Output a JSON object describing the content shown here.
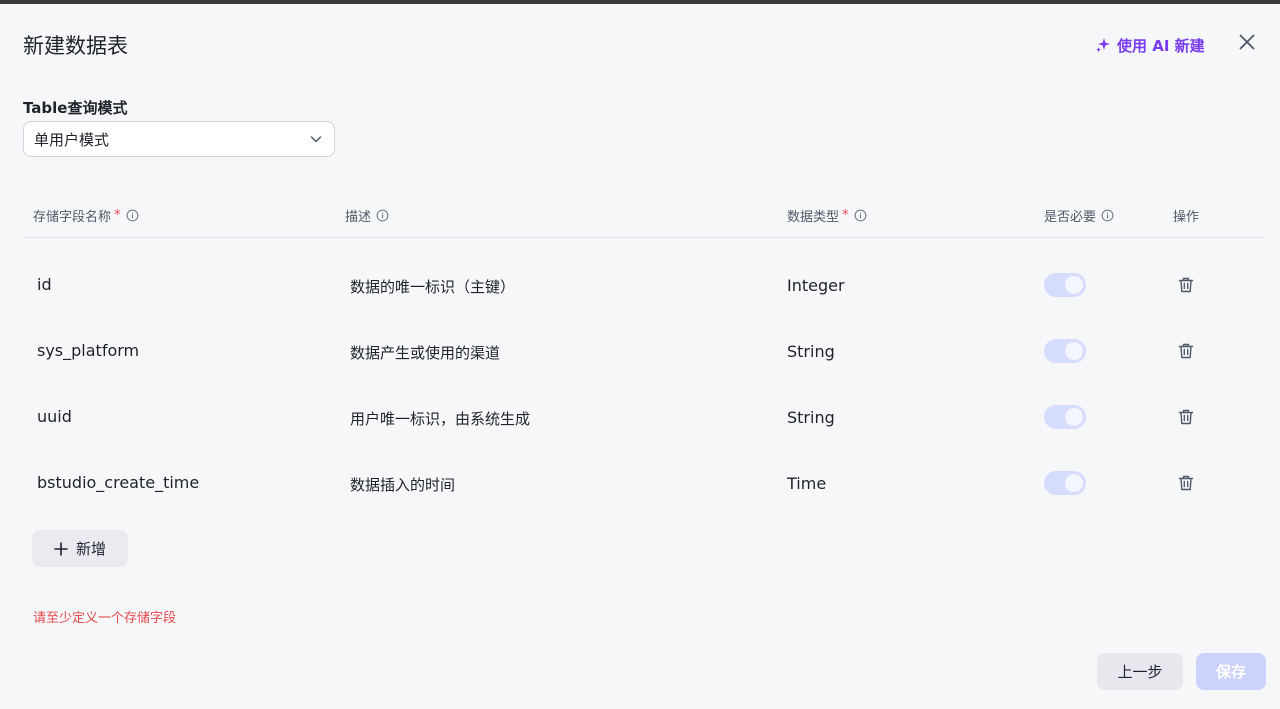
{
  "dialog": {
    "title": "新建数据表",
    "ai_button": "使用 AI 新建"
  },
  "mode": {
    "label": "Table查询模式",
    "value": "单用户模式"
  },
  "table": {
    "headers": {
      "name": "存储字段名称",
      "desc": "描述",
      "type": "数据类型",
      "required": "是否必要",
      "ops": "操作"
    },
    "rows": [
      {
        "name": "id",
        "desc": "数据的唯一标识（主键）",
        "type": "Integer",
        "required": true
      },
      {
        "name": "sys_platform",
        "desc": "数据产生或使用的渠道",
        "type": "String",
        "required": true
      },
      {
        "name": "uuid",
        "desc": "用户唯一标识，由系统生成",
        "type": "String",
        "required": true
      },
      {
        "name": "bstudio_create_time",
        "desc": "数据插入的时间",
        "type": "Time",
        "required": true
      }
    ]
  },
  "add_button": "新增",
  "error_text": "请至少定义一个存储字段",
  "footer": {
    "prev_label": "上一步",
    "save_label": "保存"
  },
  "colors": {
    "accent": "#7a3cf0",
    "error": "#e5484d",
    "save_disabled": "#cbd2fb"
  }
}
